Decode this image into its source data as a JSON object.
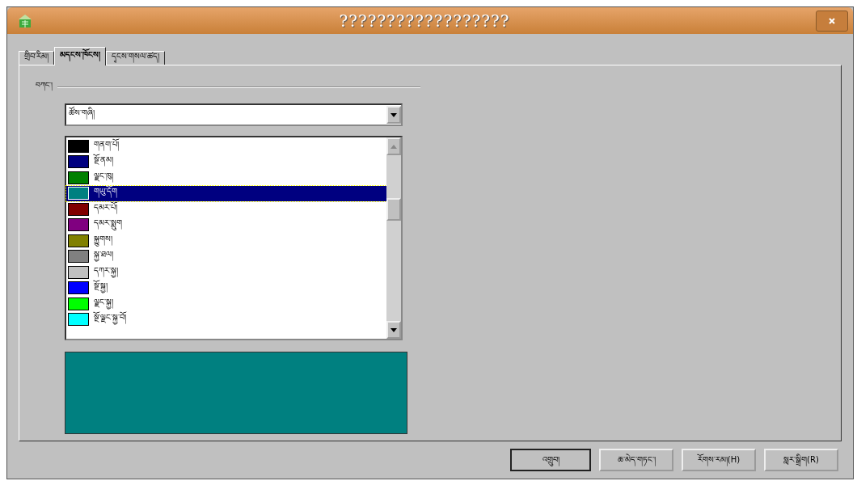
{
  "window": {
    "title": "??????????????????"
  },
  "tabs": [
    {
      "label": "གྲིབ་རིམ།",
      "selected": false
    },
    {
      "label": "མདངས་ཁོངས།",
      "selected": true
    },
    {
      "label": "དྭངས་གསལ་ཚད།",
      "selected": false
    }
  ],
  "group": {
    "label": "བཀང་།"
  },
  "dropdown": {
    "value": "ཚོས་གཞི།"
  },
  "colors": [
    {
      "name": "གནག་པོ།",
      "color": "#000000",
      "selected": false
    },
    {
      "name": "སྔོ་ནམ།",
      "color": "#000080",
      "selected": false
    },
    {
      "name": "ལྗང་ཁུ།",
      "color": "#008000",
      "selected": false
    },
    {
      "name": "གཡུ་དོག",
      "color": "#008080",
      "selected": true
    },
    {
      "name": "དམར་པོ།",
      "color": "#800000",
      "selected": false
    },
    {
      "name": "དམར་སྨུག",
      "color": "#800080",
      "selected": false
    },
    {
      "name": "སྐྱུགས།",
      "color": "#808000",
      "selected": false
    },
    {
      "name": "སྐྱ་ཐལ།",
      "color": "#808080",
      "selected": false
    },
    {
      "name": "དཀར་སྐྱ།",
      "color": "#c0c0c0",
      "selected": false
    },
    {
      "name": "སྔོ་སྐྱ།",
      "color": "#0000ff",
      "selected": false
    },
    {
      "name": "ལྗང་སྐྱ།",
      "color": "#00ff00",
      "selected": false
    },
    {
      "name": "སྔོ་ལྗང་སྐྱ་བོ།",
      "color": "#00ffff",
      "selected": false
    }
  ],
  "preview": {
    "color": "#008080"
  },
  "buttons": [
    "འགྲུབ།",
    "ཆ་མེད་གཏང་།",
    "རོགས་རམ།(H)",
    "སླར་སྒྲིག(R)"
  ]
}
